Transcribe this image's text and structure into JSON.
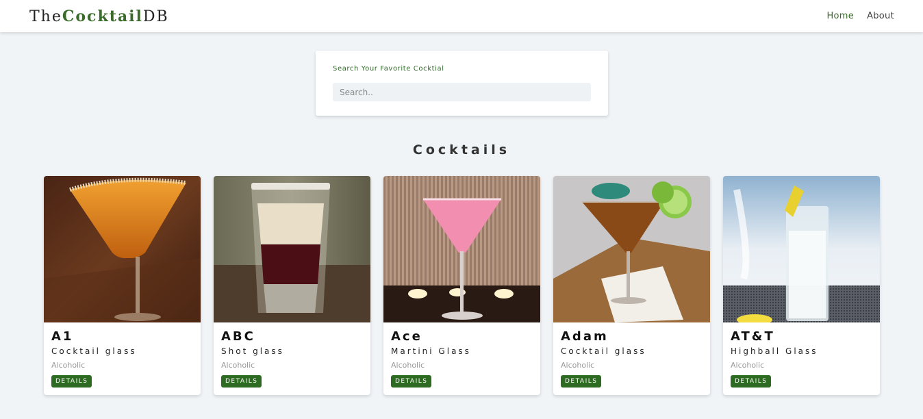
{
  "navbar": {
    "logo": {
      "prefix": "The",
      "accent": "Cocktail",
      "suffix": "DB"
    },
    "links": [
      {
        "label": "Home",
        "active": true
      },
      {
        "label": "About",
        "active": false
      }
    ]
  },
  "search": {
    "label": "Search Your Favorite Cocktial",
    "placeholder": "Search.."
  },
  "section_title": "Cocktails",
  "cocktails": [
    {
      "name": "A1",
      "glass": "Cocktail glass",
      "type": "Alcoholic",
      "button": "DETAILS",
      "image": "orange-martini-sugar-rim"
    },
    {
      "name": "ABC",
      "glass": "Shot glass",
      "type": "Alcoholic",
      "button": "DETAILS",
      "image": "layered-shot"
    },
    {
      "name": "Ace",
      "glass": "Martini Glass",
      "type": "Alcoholic",
      "button": "DETAILS",
      "image": "pink-martini-candles"
    },
    {
      "name": "Adam",
      "glass": "Cocktail glass",
      "type": "Alcoholic",
      "button": "DETAILS",
      "image": "amber-martini-lime-umbrella"
    },
    {
      "name": "AT&T",
      "glass": "Highball Glass",
      "type": "Alcoholic",
      "button": "DETAILS",
      "image": "highball-ice-lemon"
    }
  ],
  "colors": {
    "brand": "#3a6b2a",
    "button": "#2e6b22",
    "background": "#f0f4f7"
  }
}
